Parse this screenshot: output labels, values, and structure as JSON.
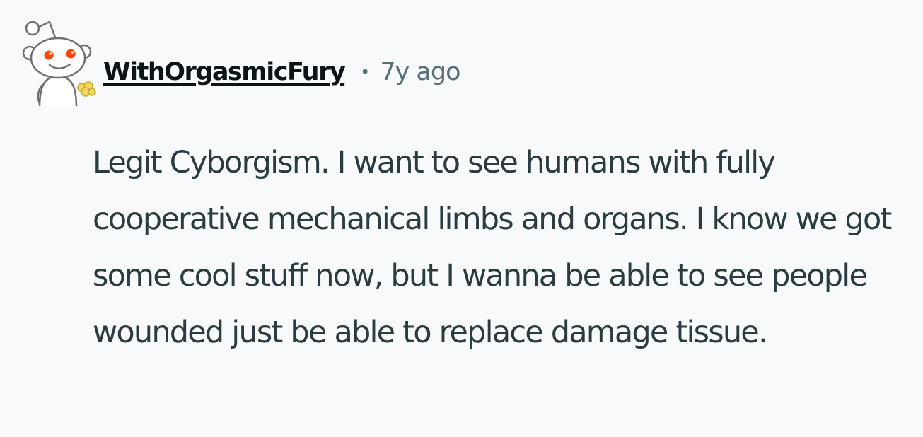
{
  "comment": {
    "author": "WithOrgasmicFury",
    "separator": "•",
    "time_ago": "7y ago",
    "body": "Legit Cyborgism. I want to see humans with fully cooperative mechanical limbs and organs. I know we got some cool stuff now, but I wanna be able to see people wounded just be able to replace damage tissue."
  },
  "icons": {
    "avatar": "snoo-avatar-icon"
  },
  "colors": {
    "background": "#f8f9fb",
    "username": "#0b1416",
    "meta": "#576f76",
    "body_text": "#2a3c42",
    "avatar_eye": "#ff4500",
    "avatar_accent": "#f2d75a"
  }
}
